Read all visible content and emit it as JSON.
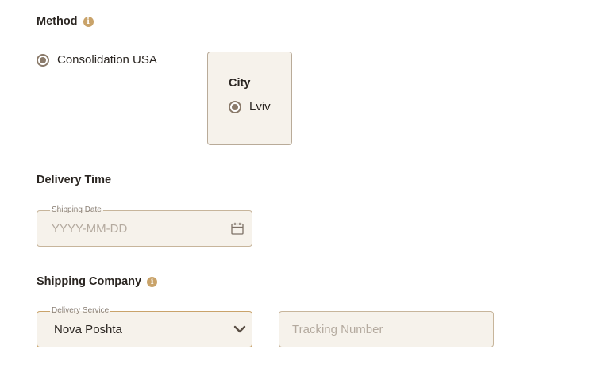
{
  "method": {
    "title": "Method",
    "info_icon": "i",
    "option_label": "Consolidation USA"
  },
  "city": {
    "title": "City",
    "option_label": "Lviv"
  },
  "delivery_time": {
    "title": "Delivery Time",
    "shipping_date": {
      "legend": "Shipping Date",
      "placeholder": "YYYY-MM-DD",
      "icon": "calendar-icon"
    }
  },
  "shipping_company": {
    "title": "Shipping Company",
    "info_icon": "i",
    "delivery_service": {
      "legend": "Delivery Service",
      "value": "Nova Poshta",
      "icon": "chevron-down-icon"
    },
    "tracking": {
      "placeholder": "Tracking Number"
    }
  },
  "colors": {
    "accent": "#c9a36a",
    "field_bg": "#f6f2eb",
    "radio": "#8a7a6a"
  }
}
